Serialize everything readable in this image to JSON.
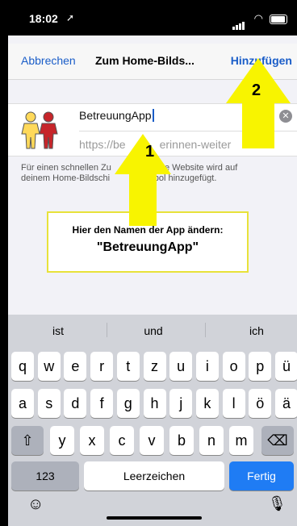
{
  "status_bar": {
    "time": "18:02",
    "location_icon": "location-arrow-icon"
  },
  "navbar": {
    "cancel": "Abbrechen",
    "title": "Zum Home-Bilds...",
    "add": "Hinzufügen"
  },
  "card": {
    "app_name_value": "BetreuungApp",
    "url_text": "https://be",
    "url_text_2": "erinnen-weiter",
    "clear_icon": "clear-icon"
  },
  "description": {
    "part1": "Für einen schnellen Zu",
    "part2": "iese Website wird auf",
    "part3": "deinem Home-Bildschi",
    "part4": "ymbol hinzugefügt."
  },
  "callout": {
    "line1": "Hier den Namen der App ändern:",
    "line2": "\"BetreuungApp\""
  },
  "annotations": {
    "arrow1_number": "1",
    "arrow2_number": "2",
    "arrow_color": "#f8f400"
  },
  "keyboard": {
    "suggestions": [
      "ist",
      "und",
      "ich"
    ],
    "row1": [
      "q",
      "w",
      "e",
      "r",
      "t",
      "z",
      "u",
      "i",
      "o",
      "p",
      "ü"
    ],
    "row2": [
      "a",
      "s",
      "d",
      "f",
      "g",
      "h",
      "j",
      "k",
      "l",
      "ö",
      "ä"
    ],
    "row3": [
      "y",
      "x",
      "c",
      "v",
      "b",
      "n",
      "m"
    ],
    "numbers_key": "123",
    "space_key": "Leerzeichen",
    "done_key": "Fertig"
  },
  "colors": {
    "accent": "#1a5dc8",
    "done_key": "#1f7cf4",
    "keyboard_bg": "#d1d3d9"
  }
}
